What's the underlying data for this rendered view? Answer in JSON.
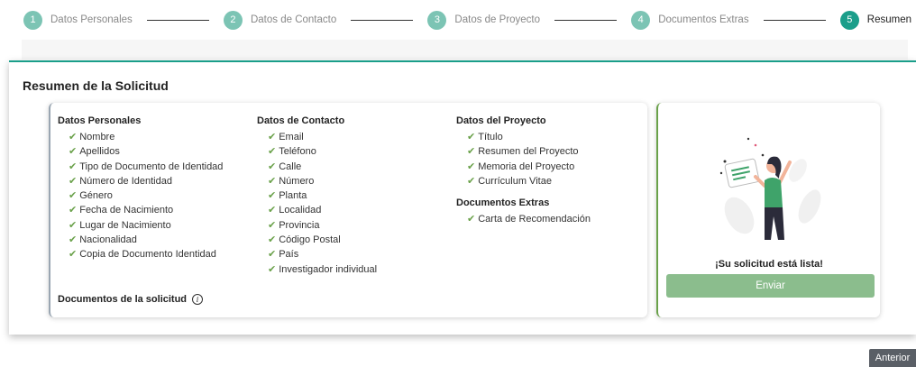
{
  "stepper": {
    "steps": [
      {
        "number": "1",
        "label": "Datos Personales"
      },
      {
        "number": "2",
        "label": "Datos de Contacto"
      },
      {
        "number": "3",
        "label": "Datos de Proyecto"
      },
      {
        "number": "4",
        "label": "Documentos Extras"
      },
      {
        "number": "5",
        "label": "Resumen"
      }
    ],
    "active_step": 5
  },
  "card": {
    "title": "Resumen de la Solicitud"
  },
  "summary": {
    "personal": {
      "title": "Datos Personales",
      "items": [
        "Nombre",
        "Apellidos",
        "Tipo de Documento de Identidad",
        "Número de Identidad",
        "Género",
        "Fecha de Nacimiento",
        "Lugar de Nacimiento",
        "Nacionalidad",
        "Copia de Documento Identidad"
      ]
    },
    "contact": {
      "title": "Datos de Contacto",
      "items": [
        "Email",
        "Teléfono",
        "Calle",
        "Número",
        "Planta",
        "Localidad",
        "Provincia",
        "Código Postal",
        "País",
        "Investigador individual"
      ]
    },
    "project": {
      "title": "Datos del Proyecto",
      "items": [
        "Título",
        "Resumen del Proyecto",
        "Memoria del Proyecto",
        "Currículum Vitae"
      ]
    },
    "extras": {
      "title": "Documentos Extras",
      "items": [
        "Carta de Recomendación"
      ]
    },
    "documents_label": "Documentos de la solicitud",
    "check_glyph": "✔",
    "info_glyph": "i"
  },
  "ready": {
    "message": "¡Su solicitud está lista!",
    "send_label": "Enviar"
  },
  "nav": {
    "prev_label": "Anterior"
  },
  "colors": {
    "accent": "#1a9e8a",
    "step_inactive": "#7cc4b4",
    "check": "#6aa14a",
    "send_button": "#8bbd8d",
    "figure_shirt": "#3fa36a"
  }
}
